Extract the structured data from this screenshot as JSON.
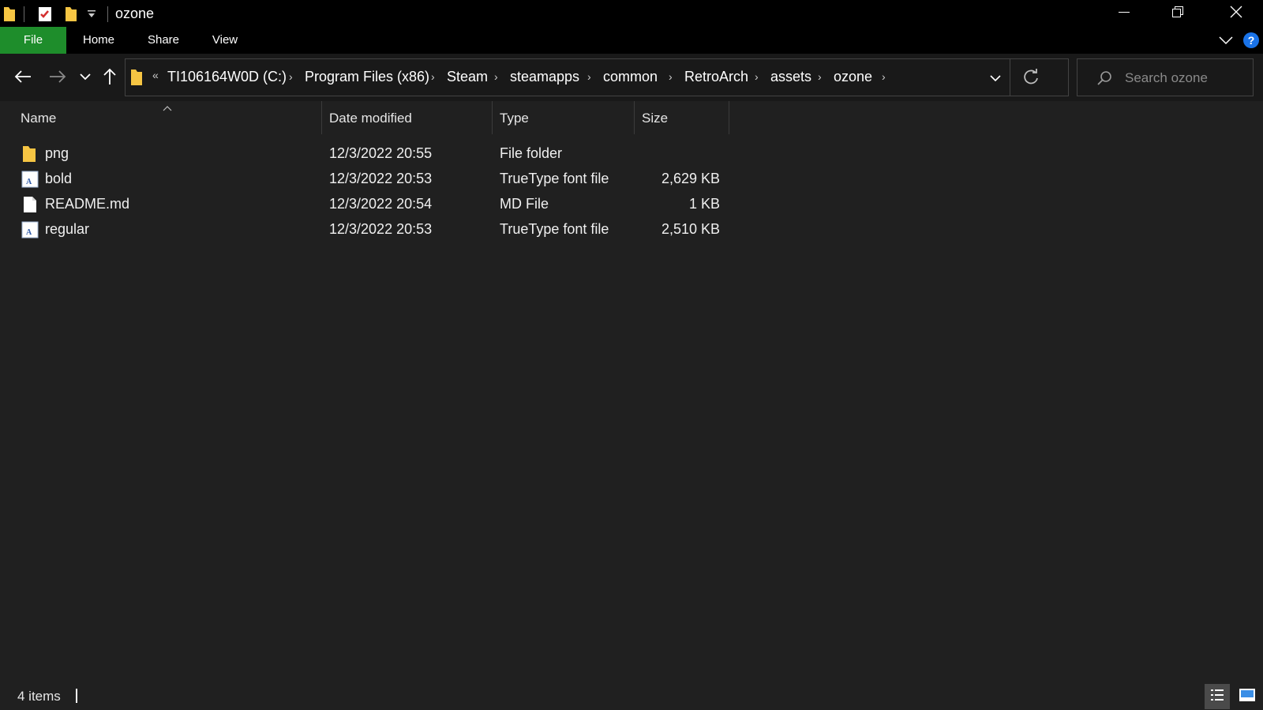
{
  "window": {
    "title": "ozone",
    "icons": [
      "folder-icon",
      "properties-checklist-icon",
      "new-folder-icon",
      "customize-qat-icon"
    ],
    "controls": [
      "minimize-icon",
      "restore-icon",
      "close-icon"
    ]
  },
  "ribbon": {
    "tabs": [
      {
        "label": "File",
        "accent": "#1e8d2b"
      },
      {
        "label": "Home"
      },
      {
        "label": "Share"
      },
      {
        "label": "View"
      }
    ]
  },
  "address": {
    "overflow": "«",
    "crumbs": [
      "TI106164W0D (C:)",
      "Program Files (x86)",
      "Steam",
      "steamapps",
      "common",
      "RetroArch",
      "assets",
      "ozone"
    ]
  },
  "search": {
    "placeholder": "Search ozone"
  },
  "table": {
    "headers": {
      "name": "Name",
      "date": "Date modified",
      "type": "Type",
      "size": "Size"
    },
    "rows": [
      {
        "name": "png",
        "date": "12/3/2022 20:55",
        "type": "File folder",
        "size": "",
        "icon": "folder-icon"
      },
      {
        "name": "bold",
        "date": "12/3/2022 20:53",
        "type": "TrueType font file",
        "size": "2,629 KB",
        "icon": "font-file-icon"
      },
      {
        "name": "README.md",
        "date": "12/3/2022 20:54",
        "type": "MD File",
        "size": "1 KB",
        "icon": "document-icon"
      },
      {
        "name": "regular",
        "date": "12/3/2022 20:53",
        "type": "TrueType font file",
        "size": "2,510 KB",
        "icon": "font-file-icon"
      }
    ]
  },
  "status": {
    "items": "4 items"
  },
  "colors": {
    "background": "#202020",
    "titlebar": "#000000",
    "accent": "#1e8d2b",
    "help": "#1a73e8"
  }
}
